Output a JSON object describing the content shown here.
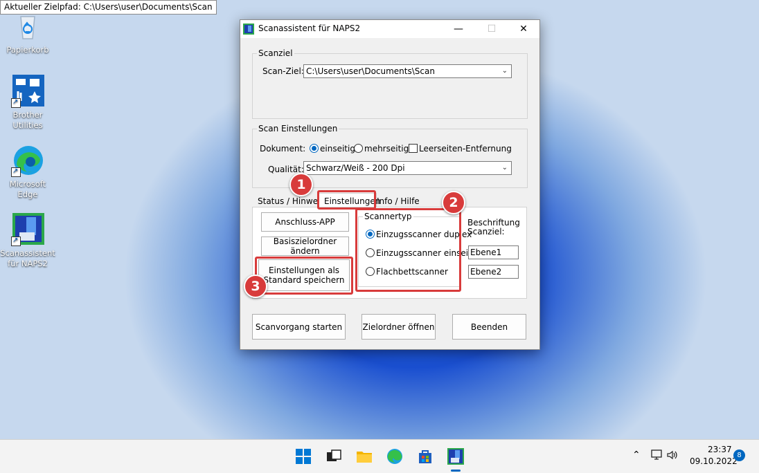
{
  "tooltip": "Aktueller Zielpfad: C:\\Users\\user\\Documents\\Scan",
  "desktop": {
    "icons": [
      {
        "label": "Papierkorb"
      },
      {
        "label": "Brother\nUtilities"
      },
      {
        "label": "Microsoft\nEdge"
      },
      {
        "label": "Scanassistent\nfür NAPS2"
      }
    ]
  },
  "window": {
    "title": "Scanassistent für NAPS2",
    "scanziel_group": "Scanziel",
    "scanziel_label": "Scan-Ziel:",
    "scanziel_value": "C:\\Users\\user\\Documents\\Scan",
    "settings_group": "Scan Einstellungen",
    "dokument_label": "Dokument:",
    "einseitig": "einseitig",
    "mehrseitig": "mehrseitig",
    "leerseiten": "Leerseiten-Entfernung",
    "qualitaet_label": "Qualität:",
    "qualitaet_value": "Schwarz/Weiß - 200 Dpi",
    "tabs": [
      "Status / Hinweise",
      "Einstellungen",
      "Info / Hilfe"
    ],
    "btn_anschluss": "Anschluss-APP",
    "btn_basis": "Basiszielordner ändern",
    "btn_standard_l1": "Einstellungen als",
    "btn_standard_l2": "Standard speichern",
    "scannertyp_group": "Scannertyp",
    "scanner_options": [
      "Einzugsscanner duplex",
      "Einzugsscanner einseitig",
      "Flachbettscanner"
    ],
    "beschriftung_l1": "Beschriftung",
    "beschriftung_l2": "Scanziel:",
    "ebene1": "Ebene1",
    "ebene2": "Ebene2",
    "btn_start": "Scanvorgang starten",
    "btn_open": "Zielordner öffnen",
    "btn_exit": "Beenden"
  },
  "annotations": [
    "1",
    "2",
    "3"
  ],
  "taskbar": {
    "time": "23:37",
    "date": "09.10.2022",
    "notifications": "8"
  },
  "colors": {
    "accent": "#0067c0",
    "highlight": "#d83b3b"
  }
}
